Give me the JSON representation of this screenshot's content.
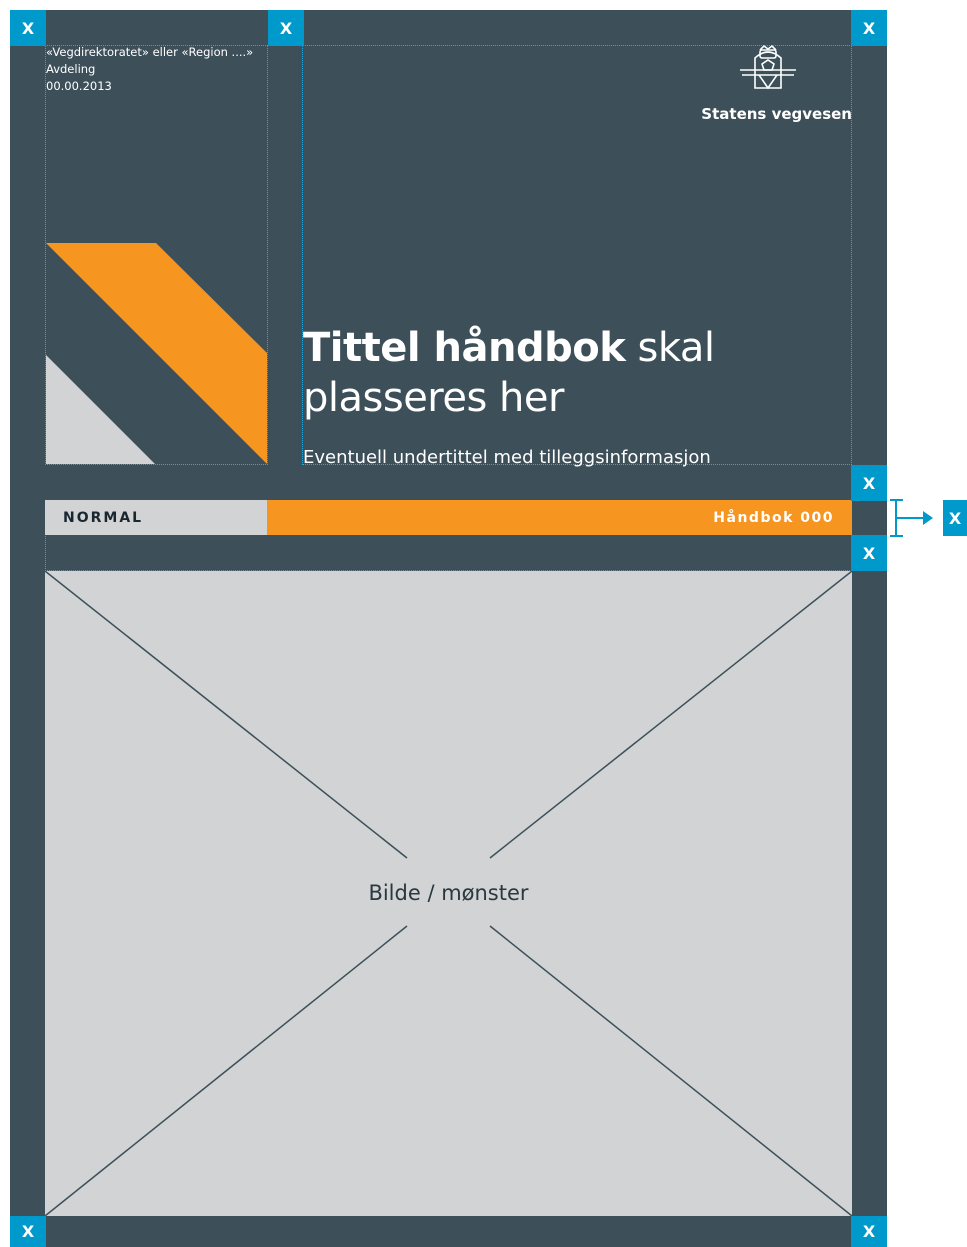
{
  "header": {
    "organization": "«Vegdirektoratet» eller «Region ....»",
    "department": "Avdeling",
    "date": "00.00.2013"
  },
  "brand": {
    "name": "Statens vegvesen",
    "logo_icon": "crown-shield-logo-icon"
  },
  "title": {
    "bold": "Tittel håndbok",
    "light_line1": " skal",
    "light_line2": "plasseres her"
  },
  "subtitle": "Eventuell undertittel med tilleggsinformasjon",
  "band": {
    "left_label": "NORMAL",
    "right_label": "Håndbok 000"
  },
  "image_placeholder": {
    "label": "Bilde / mønster"
  },
  "markers": {
    "label": "X",
    "side_label": "X"
  },
  "colors": {
    "background": "#3d4f59",
    "accent_orange": "#f6951f",
    "light_grey": "#d1d3d4",
    "marker_blue": "#0099cc"
  }
}
